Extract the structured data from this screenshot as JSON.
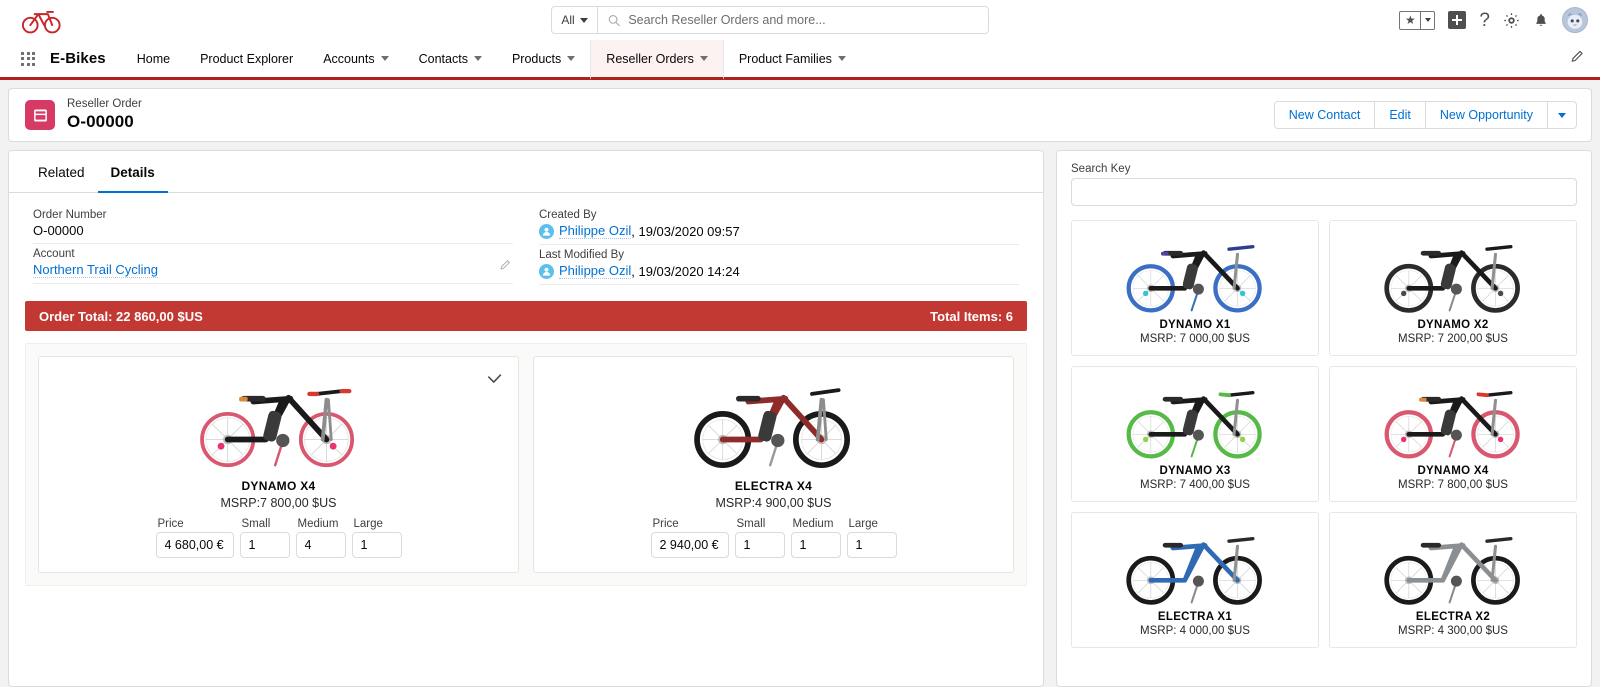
{
  "global_header": {
    "logo_name": "ebike-logo",
    "search": {
      "scope": "All",
      "placeholder": "Search Reseller Orders and more...",
      "value": ""
    },
    "actions": {
      "favorites": "favorites-star",
      "favorites_menu": "favorites-dropdown",
      "add": "global-add",
      "help": "?",
      "setup": "setup-gear",
      "notifications": "notifications-bell",
      "avatar": "user-avatar"
    }
  },
  "nav": {
    "app_launcher": "app-launcher",
    "app_name": "E-Bikes",
    "items": [
      {
        "label": "Home",
        "has_menu": false,
        "active": false
      },
      {
        "label": "Product Explorer",
        "has_menu": false,
        "active": false
      },
      {
        "label": "Accounts",
        "has_menu": true,
        "active": false
      },
      {
        "label": "Contacts",
        "has_menu": true,
        "active": false
      },
      {
        "label": "Products",
        "has_menu": true,
        "active": false
      },
      {
        "label": "Reseller Orders",
        "has_menu": true,
        "active": true
      },
      {
        "label": "Product Families",
        "has_menu": true,
        "active": false
      }
    ],
    "edit_nav": "pencil-icon"
  },
  "record": {
    "object_label": "Reseller Order",
    "title": "O-00000",
    "icon": "order-record-icon",
    "actions": [
      {
        "label": "New Contact"
      },
      {
        "label": "Edit"
      },
      {
        "label": "New Opportunity"
      }
    ],
    "actions_more": "more-actions-caret"
  },
  "left_panel": {
    "tabs": [
      {
        "label": "Related",
        "active": false
      },
      {
        "label": "Details",
        "active": true
      }
    ],
    "fields_left": [
      {
        "label": "Order Number",
        "value": "O-00000",
        "type": "text"
      },
      {
        "label": "Account",
        "value": "Northern Trail Cycling",
        "type": "link",
        "editable": true
      }
    ],
    "fields_right": [
      {
        "label": "Created By",
        "user": "Philippe Ozil",
        "meta": ", 19/03/2020 09:57"
      },
      {
        "label": "Last Modified By",
        "user": "Philippe Ozil",
        "meta": ", 19/03/2020 14:24"
      }
    ],
    "total_bar": {
      "order_total_label": "Order Total: 22 860,00 $US",
      "total_items_label": "Total Items: 6",
      "color": "#c23934"
    },
    "order_items": [
      {
        "name": "DYNAMO X4",
        "msrp": "MSRP:7 800,00 $US",
        "selected": true,
        "price_label": "Price",
        "price": "4 680,00 €",
        "sizes": [
          {
            "label": "Small",
            "value": "1"
          },
          {
            "label": "Medium",
            "value": "4"
          },
          {
            "label": "Large",
            "value": "1"
          }
        ],
        "frame_color": "#1a1a1a",
        "rim_color": "#d9576f"
      },
      {
        "name": "ELECTRA X4",
        "msrp": "MSRP:4 900,00 $US",
        "selected": false,
        "price_label": "Price",
        "price": "2 940,00 €",
        "sizes": [
          {
            "label": "Small",
            "value": "1"
          },
          {
            "label": "Medium",
            "value": "1"
          },
          {
            "label": "Large",
            "value": "1"
          }
        ],
        "frame_color": "#8e2b2b",
        "rim_color": "#1a1a1a"
      }
    ]
  },
  "right_panel": {
    "search_key_label": "Search Key",
    "search_key_value": "",
    "search_key_placeholder": "",
    "products": [
      {
        "name": "DYNAMO X1",
        "msrp": "MSRP: 7 000,00 $US",
        "frame_color": "#1a1a1a",
        "rim_color": "#3a6fc4"
      },
      {
        "name": "DYNAMO X2",
        "msrp": "MSRP: 7 200,00 $US",
        "frame_color": "#1a1a1a",
        "rim_color": "#2b2b2b"
      },
      {
        "name": "DYNAMO X3",
        "msrp": "MSRP: 7 400,00 $US",
        "frame_color": "#1a1a1a",
        "rim_color": "#57b947"
      },
      {
        "name": "DYNAMO X4",
        "msrp": "MSRP: 7 800,00 $US",
        "frame_color": "#1a1a1a",
        "rim_color": "#d9576f"
      },
      {
        "name": "ELECTRA X1",
        "msrp": "MSRP: 4 000,00 $US",
        "frame_color": "#2f6bb5",
        "rim_color": "#1a1a1a"
      },
      {
        "name": "ELECTRA X2",
        "msrp": "MSRP: 4 300,00 $US",
        "frame_color": "#8a8f94",
        "rim_color": "#1a1a1a"
      }
    ]
  }
}
